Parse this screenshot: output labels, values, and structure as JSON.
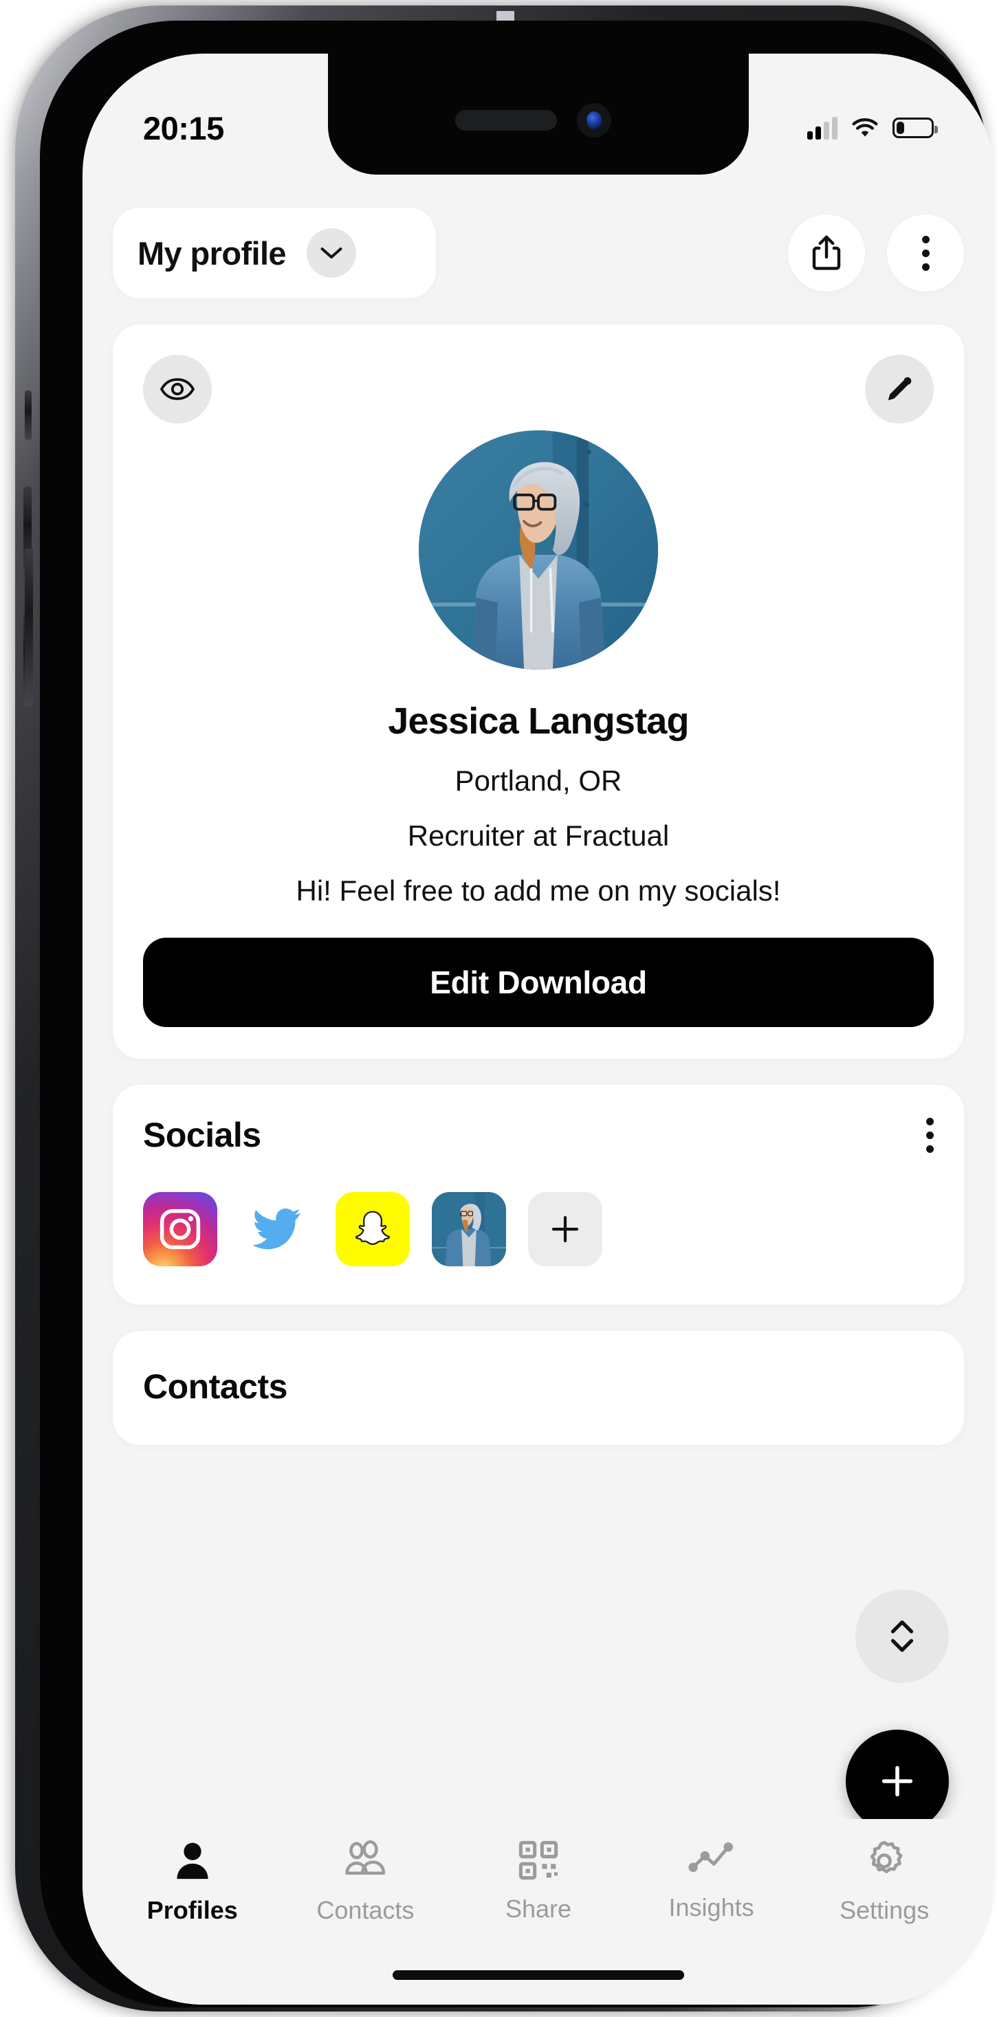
{
  "status_bar": {
    "time": "20:15",
    "signal_icon": "cellular-signal-icon",
    "signal_bars_filled": 2,
    "signal_bars_total": 4,
    "wifi_icon": "wifi-icon",
    "battery_icon": "battery-low-icon",
    "battery_level_percent": 20
  },
  "header": {
    "profile_switcher_label": "My profile",
    "chevron_icon": "chevron-down-icon",
    "share_icon": "share-icon",
    "more_icon": "more-vertical-icon"
  },
  "profile_card": {
    "preview_icon": "eye-icon",
    "edit_icon": "pencil-icon",
    "avatar_alt": "profile-photo",
    "name": "Jessica Langstag",
    "location": "Portland, OR",
    "role": "Recruiter at Fractual",
    "bio": "Hi! Feel free to add me on my socials!",
    "cta_label": "Edit Download"
  },
  "socials": {
    "title": "Socials",
    "more_icon": "more-vertical-icon",
    "items": [
      {
        "name": "instagram",
        "icon": "instagram-icon"
      },
      {
        "name": "twitter",
        "icon": "twitter-icon"
      },
      {
        "name": "snapchat",
        "icon": "snapchat-icon"
      },
      {
        "name": "photo",
        "icon": "photo-thumbnail-icon"
      },
      {
        "name": "add",
        "icon": "plus-icon"
      }
    ]
  },
  "contacts": {
    "title": "Contacts"
  },
  "floating": {
    "reorder_icon": "chevron-up-down-icon",
    "add_icon": "plus-icon"
  },
  "tabbar": {
    "items": [
      {
        "label": "Profiles",
        "icon": "person-icon",
        "active": true
      },
      {
        "label": "Contacts",
        "icon": "people-icon",
        "active": false
      },
      {
        "label": "Share",
        "icon": "qr-code-icon",
        "active": false
      },
      {
        "label": "Insights",
        "icon": "line-chart-icon",
        "active": false
      },
      {
        "label": "Settings",
        "icon": "gear-icon",
        "active": false
      }
    ]
  },
  "colors": {
    "accent": "#000000",
    "screen_bg": "#f4f4f5",
    "card_bg": "#ffffff",
    "muted_text": "#9b9b9e",
    "snapchat_yellow": "#fffc00",
    "twitter_blue": "#55acee",
    "photo_blue": "#2e7296"
  }
}
